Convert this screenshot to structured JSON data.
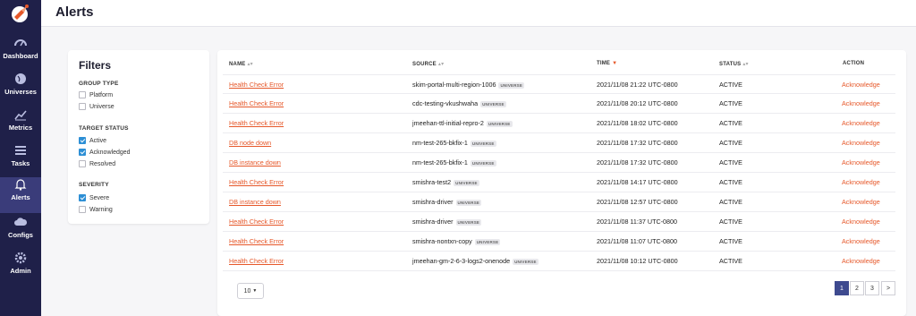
{
  "sidebar": {
    "items": [
      {
        "label": "Dashboard",
        "icon": "dashboard-icon"
      },
      {
        "label": "Universes",
        "icon": "globe-icon"
      },
      {
        "label": "Metrics",
        "icon": "chart-icon"
      },
      {
        "label": "Tasks",
        "icon": "list-icon"
      },
      {
        "label": "Alerts",
        "icon": "bell-icon",
        "active": true
      },
      {
        "label": "Configs",
        "icon": "cloud-icon"
      },
      {
        "label": "Admin",
        "icon": "gear-icon"
      }
    ]
  },
  "header": {
    "title": "Alerts"
  },
  "filters": {
    "title": "Filters",
    "groups": [
      {
        "title": "GROUP TYPE",
        "options": [
          {
            "label": "Platform",
            "checked": false
          },
          {
            "label": "Universe",
            "checked": false
          }
        ]
      },
      {
        "title": "TARGET STATUS",
        "options": [
          {
            "label": "Active",
            "checked": true
          },
          {
            "label": "Acknowledged",
            "checked": true
          },
          {
            "label": "Resolved",
            "checked": false
          }
        ]
      },
      {
        "title": "SEVERITY",
        "options": [
          {
            "label": "Severe",
            "checked": true
          },
          {
            "label": "Warning",
            "checked": false
          }
        ]
      }
    ]
  },
  "table": {
    "columns": [
      "NAME",
      "SOURCE",
      "TIME",
      "STATUS",
      "ACTION"
    ],
    "badge_label": "UNIVERSE",
    "rows": [
      {
        "name": "Health Check Error",
        "source": "skim-portal-multi-region-1006",
        "time": "2021/11/08 21:22 UTC-0800",
        "status": "ACTIVE",
        "action": "Acknowledge"
      },
      {
        "name": "Health Check Error",
        "source": "cdc-testing-vkushwaha",
        "time": "2021/11/08 20:12 UTC-0800",
        "status": "ACTIVE",
        "action": "Acknowledge"
      },
      {
        "name": "Health Check Error",
        "source": "jmeehan-ttl-initial-repro-2",
        "time": "2021/11/08 18:02 UTC-0800",
        "status": "ACTIVE",
        "action": "Acknowledge"
      },
      {
        "name": "DB node down",
        "source": "nm-test-265-bkfix-1",
        "time": "2021/11/08 17:32 UTC-0800",
        "status": "ACTIVE",
        "action": "Acknowledge"
      },
      {
        "name": "DB instance down",
        "source": "nm-test-265-bkfix-1",
        "time": "2021/11/08 17:32 UTC-0800",
        "status": "ACTIVE",
        "action": "Acknowledge"
      },
      {
        "name": "Health Check Error",
        "source": "smishra-test2",
        "time": "2021/11/08 14:17 UTC-0800",
        "status": "ACTIVE",
        "action": "Acknowledge"
      },
      {
        "name": "DB instance down",
        "source": "smishra-driver",
        "time": "2021/11/08 12:57 UTC-0800",
        "status": "ACTIVE",
        "action": "Acknowledge"
      },
      {
        "name": "Health Check Error",
        "source": "smishra-driver",
        "time": "2021/11/08 11:37 UTC-0800",
        "status": "ACTIVE",
        "action": "Acknowledge"
      },
      {
        "name": "Health Check Error",
        "source": "smishra-nontxn-copy",
        "time": "2021/11/08 11:07 UTC-0800",
        "status": "ACTIVE",
        "action": "Acknowledge"
      },
      {
        "name": "Health Check Error",
        "source": "jmeehan-gm-2-6-3-logs2-onenode",
        "time": "2021/11/08 10:12 UTC-0800",
        "status": "ACTIVE",
        "action": "Acknowledge"
      }
    ]
  },
  "pagination": {
    "page_size": "10",
    "pages": [
      "1",
      "2",
      "3"
    ],
    "current": "1",
    "next": ">"
  },
  "colors": {
    "sidebar": "#1f2049",
    "accent": "#e6582a",
    "checkbox": "#2d8fd5",
    "pager_active": "#3e4a8f"
  }
}
